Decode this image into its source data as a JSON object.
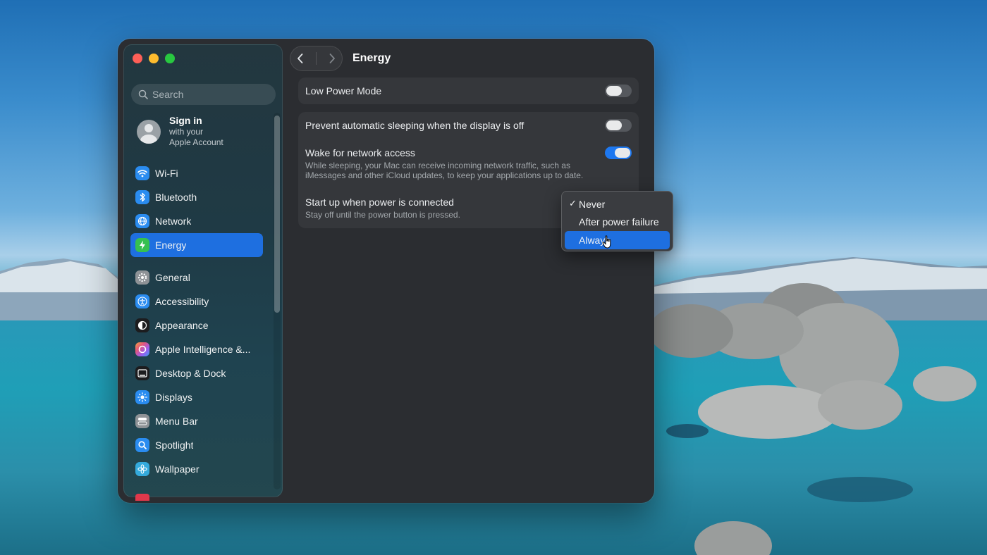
{
  "sidebar": {
    "search_placeholder": "Search",
    "account": {
      "title": "Sign in",
      "line1": "with your",
      "line2": "Apple Account"
    },
    "group1": [
      {
        "label": "Wi-Fi",
        "icon": "wifi-icon",
        "color": "#2a8cf0"
      },
      {
        "label": "Bluetooth",
        "icon": "bluetooth-icon",
        "color": "#2a8cf0"
      },
      {
        "label": "Network",
        "icon": "globe-icon",
        "color": "#2a8cf0"
      },
      {
        "label": "Energy",
        "icon": "bolt-icon",
        "color": "#36c04f",
        "selected": true
      }
    ],
    "group2": [
      {
        "label": "General",
        "icon": "gear-icon",
        "color": "#8e9296"
      },
      {
        "label": "Accessibility",
        "icon": "accessibility-icon",
        "color": "#2a8cf0"
      },
      {
        "label": "Appearance",
        "icon": "appearance-icon",
        "color": "#1c1c1e"
      },
      {
        "label": "Apple Intelligence &...",
        "icon": "apple-intelligence-icon",
        "color": "#d37bd8"
      },
      {
        "label": "Desktop & Dock",
        "icon": "dock-icon",
        "color": "#1c1c1e"
      },
      {
        "label": "Displays",
        "icon": "sun-icon",
        "color": "#2a8cf0"
      },
      {
        "label": "Menu Bar",
        "icon": "menu-bar-icon",
        "color": "#8e9296"
      },
      {
        "label": "Spotlight",
        "icon": "magnifier-icon",
        "color": "#2a8cf0"
      },
      {
        "label": "Wallpaper",
        "icon": "flower-icon",
        "color": "#34aadc"
      }
    ]
  },
  "header": {
    "title": "Energy"
  },
  "settings": {
    "low_power": {
      "title": "Low Power Mode",
      "on": false
    },
    "prevent_sleep": {
      "title": "Prevent automatic sleeping when the display is off",
      "on": false
    },
    "wake_network": {
      "title": "Wake for network access",
      "desc1": "While sleeping, your Mac can receive incoming network traffic, such as",
      "desc2": "iMessages and other iCloud updates, to keep your applications up to date.",
      "on": true
    },
    "startup": {
      "title": "Start up when power is connected",
      "desc": "Stay off until the power button is pressed."
    }
  },
  "popup_menu": {
    "options": [
      "Never",
      "After power failure",
      "Always"
    ],
    "checked": "Never",
    "highlighted": "Always",
    "checkmark": "✓"
  }
}
